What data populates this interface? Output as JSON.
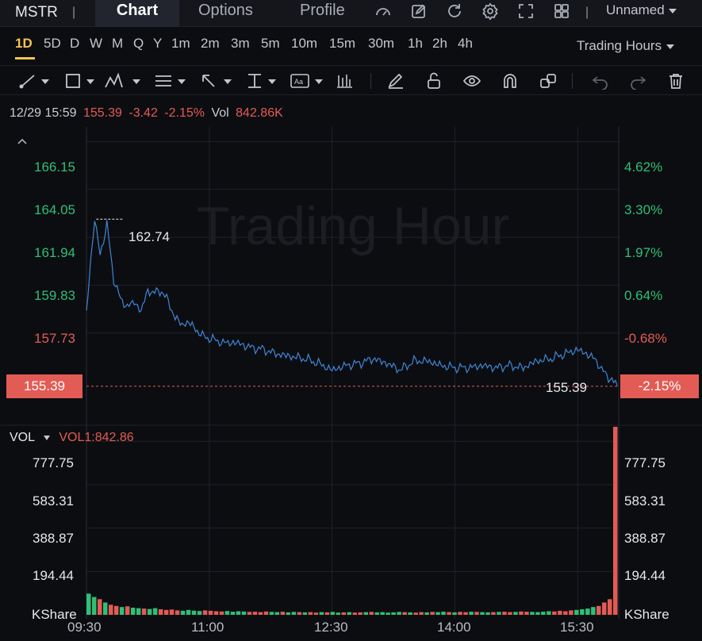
{
  "colors": {
    "background": "#0c0d11",
    "line": "#3f86d6",
    "up": "#2fbf77",
    "down": "#e35b55",
    "accent": "#f5c451"
  },
  "header": {
    "ticker": "MSTR",
    "tabs": [
      "Chart",
      "Options",
      "Profile"
    ],
    "active_tab": "Chart",
    "layout_name": "Unnamed",
    "icons": [
      "speedometer-icon",
      "edit-icon",
      "refresh-icon",
      "gear-icon",
      "fullscreen-icon",
      "grid-icon"
    ]
  },
  "timeframes": {
    "items": [
      "1D",
      "5D",
      "D",
      "W",
      "M",
      "Q",
      "Y",
      "1m",
      "2m",
      "3m",
      "5m",
      "10m",
      "15m",
      "30m",
      "1h",
      "2h",
      "4h"
    ],
    "active": "1D",
    "session": "Trading Hours"
  },
  "drawing_tools": [
    "line-tool-icon",
    "rectangle-tool-icon",
    "pattern-tool-icon",
    "fib-tool-icon",
    "arrow-tool-icon",
    "measure-tool-icon",
    "text-tool-icon",
    "indicator-icon",
    "pen-icon",
    "unlock-icon",
    "eye-icon",
    "magnet-icon",
    "link-icon",
    "undo-icon",
    "redo-icon",
    "trash-icon"
  ],
  "quote": {
    "datetime": "12/29 15:59",
    "price": "155.39",
    "change": "-3.42",
    "change_pct": "-2.15%",
    "vol_label": "Vol",
    "volume": "842.86K"
  },
  "price_axis": {
    "left_ticks": [
      "166.15",
      "164.05",
      "161.94",
      "159.83",
      "157.73"
    ],
    "right_ticks": [
      "4.62%",
      "3.30%",
      "1.97%",
      "0.64%",
      "-0.68%"
    ],
    "current_price": "155.39",
    "current_pct": "-2.15%",
    "high_label": "162.74",
    "last_label": "155.39"
  },
  "watermark": "Trading Hour",
  "volume_panel": {
    "title": "VOL",
    "indicator": "VOL1:842.86",
    "ticks": [
      "777.75",
      "583.31",
      "388.87",
      "194.44"
    ],
    "unit": "KShare"
  },
  "time_axis": [
    "09:30",
    "11:00",
    "12:30",
    "14:00",
    "15:30"
  ],
  "chart_data": {
    "type": "line",
    "title": "",
    "xlabel": "",
    "ylabel": "",
    "x_range": [
      "09:30",
      "16:00"
    ],
    "ylim": [
      155.0,
      166.8
    ],
    "series": [
      {
        "x": [
          "09:30",
          "09:33",
          "09:36",
          "09:40",
          "09:45",
          "09:50",
          "09:55",
          "10:00",
          "10:05",
          "10:10",
          "10:15",
          "10:20",
          "10:25",
          "10:30",
          "10:35",
          "10:40",
          "10:45",
          "10:50",
          "10:55",
          "11:00",
          "11:10",
          "11:20",
          "11:30",
          "11:40",
          "11:50",
          "12:00",
          "12:10",
          "12:20",
          "12:30",
          "12:40",
          "12:50",
          "13:00",
          "13:10",
          "13:20",
          "13:30",
          "13:40",
          "13:50",
          "14:00",
          "14:10",
          "14:20",
          "14:30",
          "14:40",
          "14:50",
          "15:00",
          "15:10",
          "15:20",
          "15:30",
          "15:40",
          "15:45",
          "15:50",
          "15:55",
          "15:59"
        ],
        "values": [
          158.6,
          160.8,
          162.74,
          161.2,
          162.5,
          160.1,
          159.2,
          158.9,
          159.1,
          158.7,
          159.6,
          159.5,
          159.6,
          159.1,
          158.4,
          158.1,
          158.2,
          157.9,
          157.6,
          157.5,
          157.3,
          157.3,
          157.1,
          157.0,
          156.8,
          156.7,
          156.6,
          156.4,
          156.1,
          156.3,
          156.4,
          156.6,
          156.4,
          156.1,
          156.5,
          156.5,
          156.3,
          156.2,
          156.2,
          156.3,
          156.2,
          156.3,
          156.2,
          156.5,
          156.6,
          156.8,
          157.0,
          156.7,
          156.4,
          155.9,
          155.7,
          155.39
        ]
      }
    ],
    "volume": {
      "unit": "KShare",
      "ylim": [
        0,
        842.86
      ],
      "last_bar": 842.86,
      "values": [
        95,
        80,
        70,
        55,
        45,
        40,
        35,
        38,
        32,
        30,
        28,
        26,
        30,
        25,
        22,
        24,
        20,
        18,
        22,
        19,
        17,
        20,
        18,
        16,
        15,
        17,
        14,
        16,
        15,
        13,
        14,
        12,
        15,
        13,
        12,
        14,
        11,
        13,
        12,
        11,
        12,
        10,
        12,
        11,
        13,
        10,
        11,
        12,
        10,
        11,
        12,
        13,
        11,
        12,
        10,
        11,
        13,
        12,
        11,
        10,
        12,
        11,
        13,
        12,
        14,
        12,
        11,
        13,
        12,
        14,
        13,
        12,
        11,
        12,
        13,
        14,
        12,
        13,
        15,
        14,
        13,
        12,
        14,
        16,
        15,
        18,
        16,
        20,
        22,
        25,
        28,
        35,
        40,
        55,
        70,
        842.86
      ]
    }
  }
}
